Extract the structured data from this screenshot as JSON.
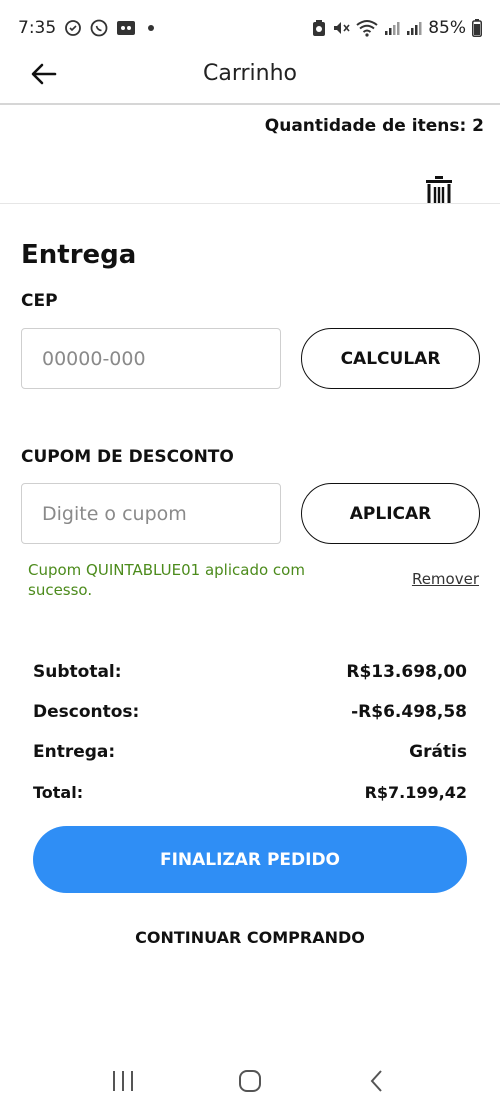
{
  "status_bar": {
    "time": "7:35",
    "battery_percent": "85%",
    "icons_left": [
      "activity-icon",
      "whatsapp-icon",
      "voicemail-icon",
      "notification-dot"
    ],
    "icons_right": [
      "nfc-icon",
      "mute-icon",
      "wifi-icon",
      "signal-icon",
      "signal-icon",
      "battery-icon"
    ]
  },
  "header": {
    "title": "Carrinho",
    "back_icon": "arrow-left-icon"
  },
  "cart": {
    "item_count_label": "Quantidade de itens: 2",
    "trash_icon": "trash-icon"
  },
  "delivery": {
    "section_title": "Entrega",
    "cep_label": "CEP",
    "cep_value": "",
    "cep_placeholder": "00000-000",
    "calculate_button": "CALCULAR"
  },
  "coupon": {
    "label": "CUPOM DE DESCONTO",
    "value": "",
    "placeholder": "Digite o cupom",
    "apply_button": "APLICAR",
    "success_message": "Cupom QUINTABLUE01 aplicado com sucesso.",
    "remove_link": "Remover"
  },
  "totals": {
    "rows": [
      {
        "label": "Subtotal:",
        "value": "R$13.698,00"
      },
      {
        "label": "Descontos:",
        "value": "-R$6.498,58"
      },
      {
        "label": "Entrega:",
        "value": "Grátis"
      },
      {
        "label": "Total:",
        "value": "R$7.199,42"
      }
    ]
  },
  "actions": {
    "checkout_button": "FINALIZAR PEDIDO",
    "continue_link": "CONTINUAR COMPRANDO"
  },
  "colors": {
    "primary": "#2f8ef5",
    "success": "#4c8b1c",
    "text": "#111111",
    "border": "#cfcfcf"
  },
  "navbar": {
    "icons": [
      "recent-apps-icon",
      "home-icon",
      "back-icon"
    ]
  }
}
